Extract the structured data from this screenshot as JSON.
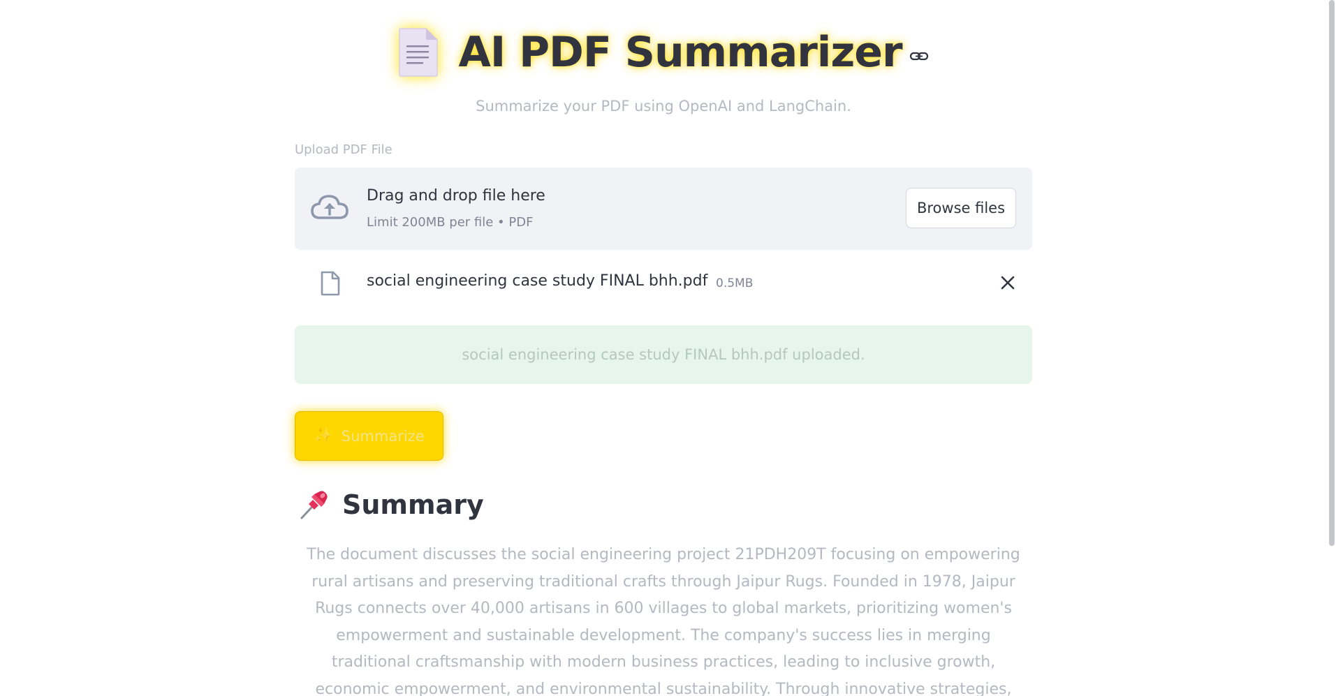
{
  "header": {
    "title": "AI PDF Summarizer",
    "subtitle": "Summarize your PDF using OpenAI and LangChain.",
    "doc_icon": "page-facing-up-icon",
    "anchor_icon": "link-icon"
  },
  "uploader": {
    "label": "Upload PDF File",
    "dropzone_title": "Drag and drop file here",
    "dropzone_subtitle": "Limit 200MB per file • PDF",
    "browse_label": "Browse files",
    "upload_icon": "cloud-upload-icon"
  },
  "uploaded_file": {
    "name": "social engineering case study FINAL bhh.pdf",
    "size": "0.5MB",
    "file_icon": "file-icon",
    "remove_icon": "close-icon"
  },
  "success_message": "social engineering case study FINAL bhh.pdf uploaded.",
  "summarize_button": {
    "icon": "sparkles-icon",
    "label": "Summarize"
  },
  "summary": {
    "icon": "pushpin-icon",
    "title": "Summary",
    "text": "The document discusses the social engineering project 21PDH209T focusing on empowering rural artisans and preserving traditional crafts through Jaipur Rugs. Founded in 1978, Jaipur Rugs connects over 40,000 artisans in 600 villages to global markets, prioritizing women's empowerment and sustainable development. The company's success lies in merging traditional craftsmanship with modern business practices, leading to inclusive growth, economic empowerment, and environmental sustainability. Through innovative strategies, Jaipur Rugs has achieved global recognition, revenue generation, and"
  },
  "colors": {
    "accent": "#ffd700",
    "success_bg": "#e6f6ec",
    "dropzone_bg": "#f0f2f6",
    "text": "#31333f",
    "muted": "#b5b8c0"
  }
}
